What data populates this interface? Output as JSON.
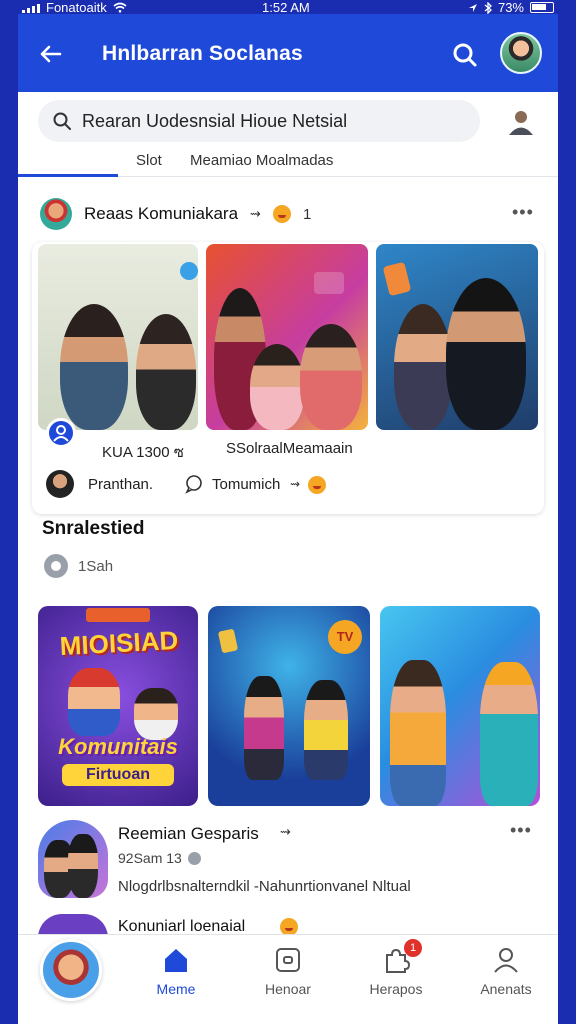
{
  "status_bar": {
    "carrier": "Fonatoaitk",
    "time": "1:52 AM",
    "battery": "73%"
  },
  "header": {
    "title": "Hnlbarran Soclanas"
  },
  "search": {
    "placeholder": "Rearan Uodesnsial Hioue Netsial"
  },
  "tabs": [
    {
      "label": "Slot"
    },
    {
      "label": "Meamiao Moalmadas"
    }
  ],
  "post1": {
    "name": "Reaas Komuniakara",
    "suffix": "1",
    "meta_left": "KUA 1300 ซ",
    "meta_right": "SSolraalMeamaain",
    "author": "Pranthan.",
    "comment": "Tomumich"
  },
  "section": {
    "title": "Snralestied",
    "time": "1Sah"
  },
  "games": [
    {
      "title_top": "MIOISIAD",
      "title_main": "Komunitais",
      "title_sub": "Firtuoan"
    },
    {
      "badge": "TV"
    }
  ],
  "post2": {
    "name": "Reemian Gesparis",
    "time": "92Sam 13",
    "desc": "Nlogdrlbsnalterndkil -Nahunrtionvanel Nltual"
  },
  "post3": {
    "name": "Konuniarl loenaial"
  },
  "bottom_nav": [
    {
      "label": "Meme",
      "icon": "home-icon",
      "active": true
    },
    {
      "label": "Henoar",
      "icon": "square-icon",
      "active": false
    },
    {
      "label": "Herapos",
      "icon": "puzzle-icon",
      "active": false,
      "badge": "1"
    },
    {
      "label": "Anenats",
      "icon": "profile-icon",
      "active": false
    }
  ],
  "colors": {
    "header_blue": "#1f49d8",
    "background": "#1a2db0",
    "badge_red": "#e0312b"
  }
}
